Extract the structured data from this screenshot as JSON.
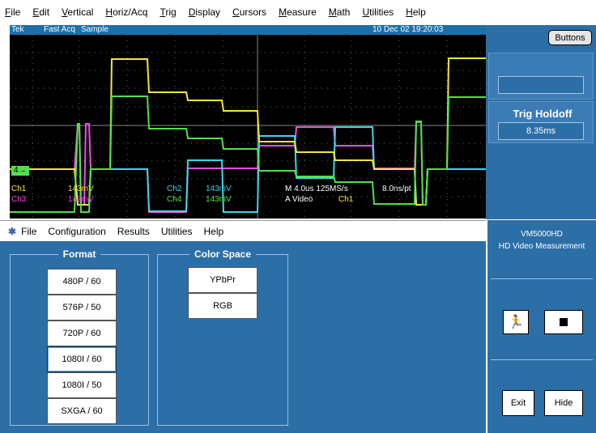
{
  "menu": [
    "File",
    "Edit",
    "Vertical",
    "Horiz/Acq",
    "Trig",
    "Display",
    "Cursors",
    "Measure",
    "Math",
    "Utilities",
    "Help"
  ],
  "status": {
    "brand": "Tek",
    "mode": "Fast Acq",
    "acq": "Sample",
    "datetime": "10 Dec 02 19:20:03"
  },
  "scope": {
    "ch1": "Ch1",
    "ch1_val": "143mV",
    "ch2": "Ch2",
    "ch2_val": "143mV",
    "ch3": "Ch3",
    "ch3_val": "143mV",
    "ch4": "Ch4",
    "ch4_val": "143mV",
    "timebase": "M 4.0us 125MS/s",
    "res": "8.0ns/pt",
    "trig": "A  Video",
    "trig_src": "Ch1",
    "marker": "4"
  },
  "right_panel": {
    "buttons_label": "Buttons",
    "holdoff_title": "Trig Holdoff",
    "holdoff_value": "8.35ms"
  },
  "app_menu": [
    "File",
    "Configuration",
    "Results",
    "Utilities",
    "Help"
  ],
  "format": {
    "title": "Format",
    "options": [
      "480P / 60",
      "576P / 50",
      "720P / 60",
      "1080I / 60",
      "1080I / 50",
      "SXGA / 60"
    ],
    "selected": "1080I / 60"
  },
  "color_space": {
    "title": "Color Space",
    "options": [
      "YPbPr",
      "RGB"
    ]
  },
  "vm": {
    "title": "VM5000HD",
    "subtitle": "HD Video Measurement",
    "exit": "Exit",
    "hide": "Hide"
  },
  "colors": {
    "panel": "#2c6ea6",
    "ch1": "#f5e43a",
    "ch2": "#3bd7e8",
    "ch3": "#f04be8",
    "ch4": "#52e04a"
  }
}
